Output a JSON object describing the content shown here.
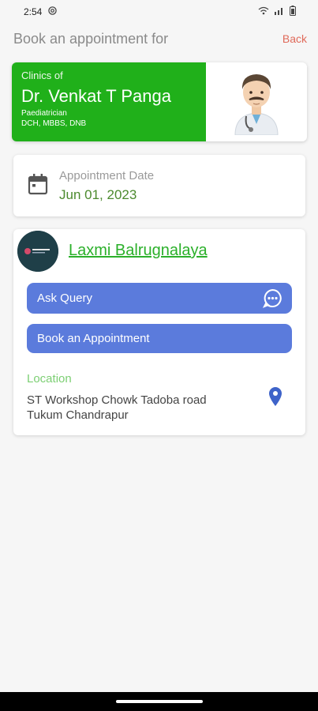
{
  "status_bar": {
    "time": "2:54",
    "icons": [
      "at-sign-icon",
      "wifi-icon",
      "signal-icon",
      "battery-icon"
    ]
  },
  "header": {
    "title": "Book an appointment for",
    "back_label": "Back"
  },
  "doctor": {
    "clinics_of_label": "Clinics of",
    "name": "Dr. Venkat T Panga",
    "specialty": "Paediatrician",
    "degrees": "DCH, MBBS, DNB",
    "avatar_icon": "doctor-avatar-icon"
  },
  "appointment": {
    "date_label": "Appointment Date",
    "date_value": "Jun 01, 2023",
    "icon": "calendar-icon"
  },
  "clinic": {
    "name": "Laxmi Balrugnalaya",
    "ask_query_label": "Ask Query",
    "book_label": "Book an Appointment",
    "location_label": "Location",
    "location_line1": "ST Workshop Chowk Tadoba road",
    "location_line2": "Tukum Chandrapur",
    "logo_icon": "clinic-logo",
    "chat_icon": "chat-bubble-icon",
    "pin_icon": "location-pin-icon"
  },
  "colors": {
    "accent_green": "#20b01a",
    "button_blue": "#5b7bdc",
    "back_red": "#e06a5a",
    "link_green": "#2bb02a"
  }
}
